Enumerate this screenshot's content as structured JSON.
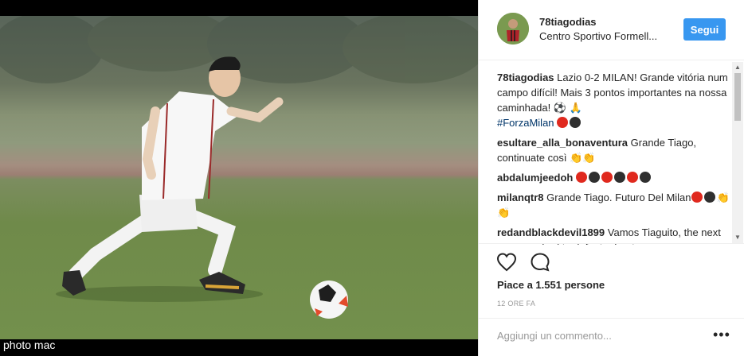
{
  "post": {
    "username": "78tiagodias",
    "location": "Centro Sportivo Formell...",
    "follow_label": "Segui",
    "photo_watermark": "photo mac"
  },
  "comments": [
    {
      "user": "78tiagodias",
      "text": "Lazio 0-2 MILAN! Grande vitória num campo difícil! Mais 3 pontos importantes na nossa caminhada! ⚽ 🙏",
      "hashtag": "#ForzaMilan",
      "emoji_dots": [
        "red",
        "black"
      ]
    },
    {
      "user": "esultare_alla_bonaventura",
      "text": "Grande Tiago, continuate così 👏👏",
      "emoji_dots": []
    },
    {
      "user": "abdalumjeedoh",
      "text": "",
      "emoji_dots": [
        "red",
        "black",
        "red",
        "black",
        "red",
        "black"
      ]
    },
    {
      "user": "milanqtr8",
      "text": "Grande Tiago. Futuro Del Milan",
      "emoji_dots": [
        "red",
        "black"
      ],
      "suffix": "👏👏"
    },
    {
      "user": "redandblackdevil1899",
      "text": "Vamos Tiaguito, the next game we had to defeat rubentus",
      "emoji_dots": []
    }
  ],
  "actions": {
    "likes_text": "Piace a 1.551 persone",
    "time_ago": "12 ORE FA"
  },
  "add_comment": {
    "placeholder": "Aggiungi un commento...",
    "more_label": "•••"
  },
  "colors": {
    "follow_button": "#3897f0",
    "text": "#262626",
    "milan_red": "#e0291e",
    "milan_black": "#2f2f2f"
  },
  "icons": [
    "heart-icon",
    "comment-icon",
    "more-options-icon"
  ]
}
